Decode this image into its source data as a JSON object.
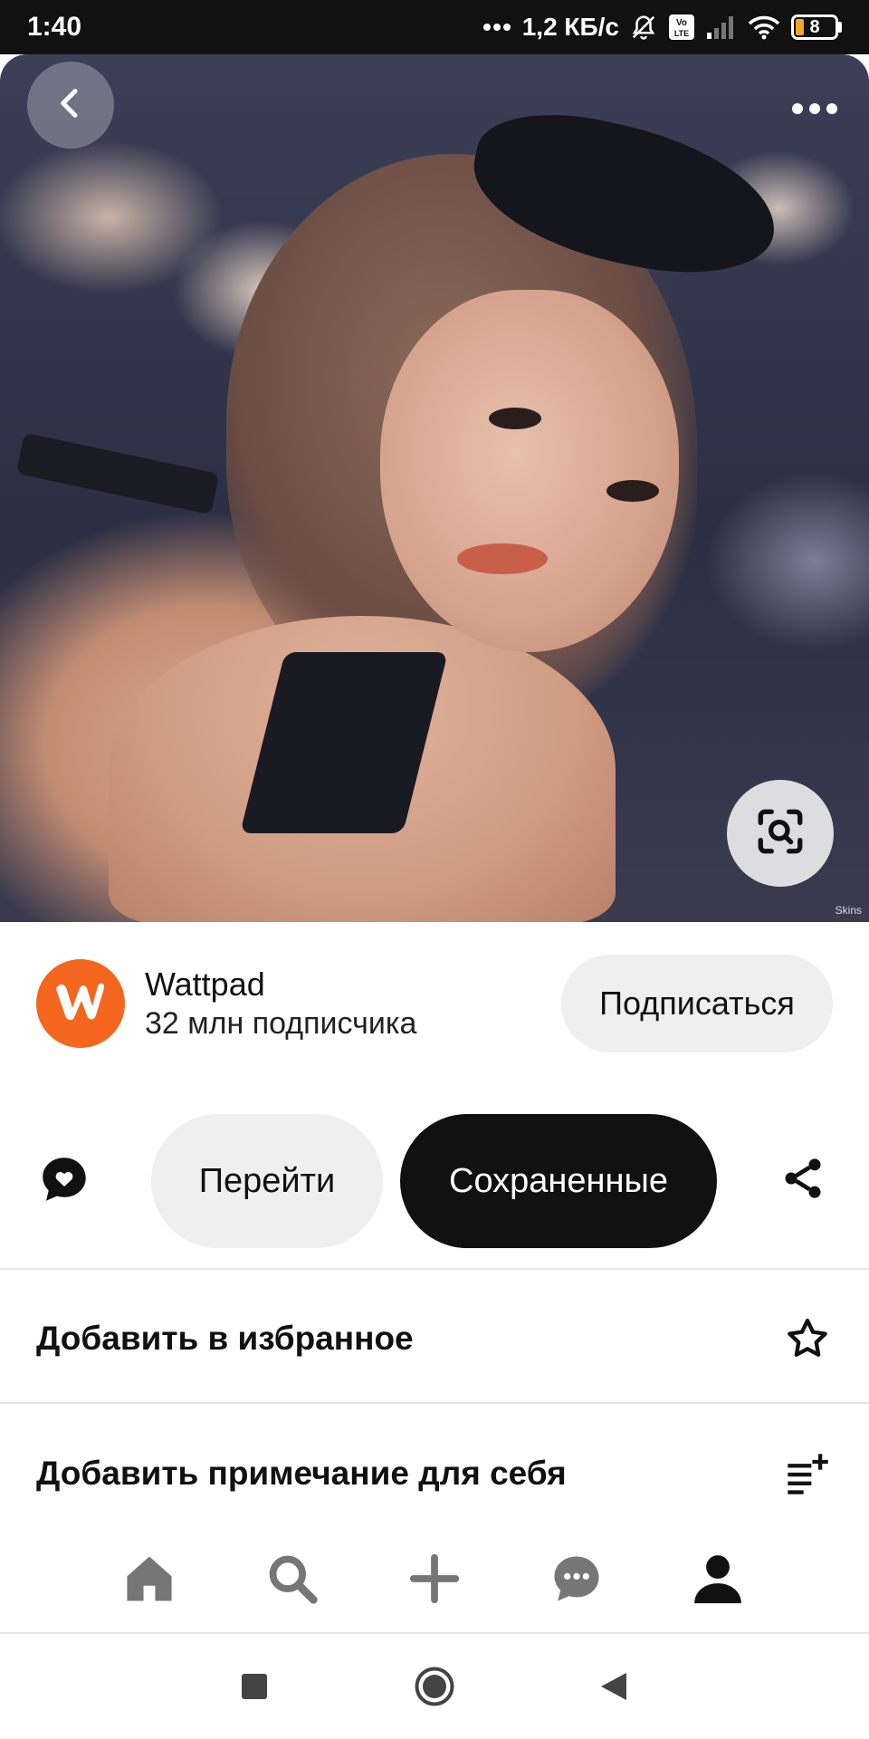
{
  "status_bar": {
    "time": "1:40",
    "network_speed": "1,2 КБ/с",
    "battery_level": "8",
    "icons": [
      "dots-icon",
      "bell-off-icon",
      "volte-icon",
      "signal-icon",
      "wifi-icon",
      "battery-icon"
    ]
  },
  "pin": {
    "watermark": "Skins",
    "icons": {
      "back": "back-arrow-icon",
      "more": "more-dots-icon",
      "lens": "visual-search-icon"
    }
  },
  "creator": {
    "name": "Wattpad",
    "followers": "32 млн подписчика",
    "follow_label": "Подписаться",
    "avatar_color": "#F4661E"
  },
  "actions": {
    "visit_label": "Перейти",
    "saved_label": "Сохраненные",
    "comment_icon": "comment-heart-icon",
    "share_icon": "share-icon"
  },
  "menu": {
    "favorite_label": "Добавить в избранное",
    "favorite_icon": "star-icon",
    "note_label": "Добавить примечание для себя",
    "note_icon": "add-note-icon"
  },
  "bottom_nav": {
    "items": [
      "home-icon",
      "search-icon",
      "plus-icon",
      "messages-icon",
      "profile-icon"
    ],
    "active": "profile-icon"
  },
  "system_nav": {
    "items": [
      "recents-icon",
      "home-circle-icon",
      "back-triangle-icon"
    ]
  },
  "colors": {
    "accent_black": "#111111",
    "button_gray": "#EFEFEF",
    "wattpad_orange": "#F4661E",
    "nav_icon_gray": "#767676"
  }
}
